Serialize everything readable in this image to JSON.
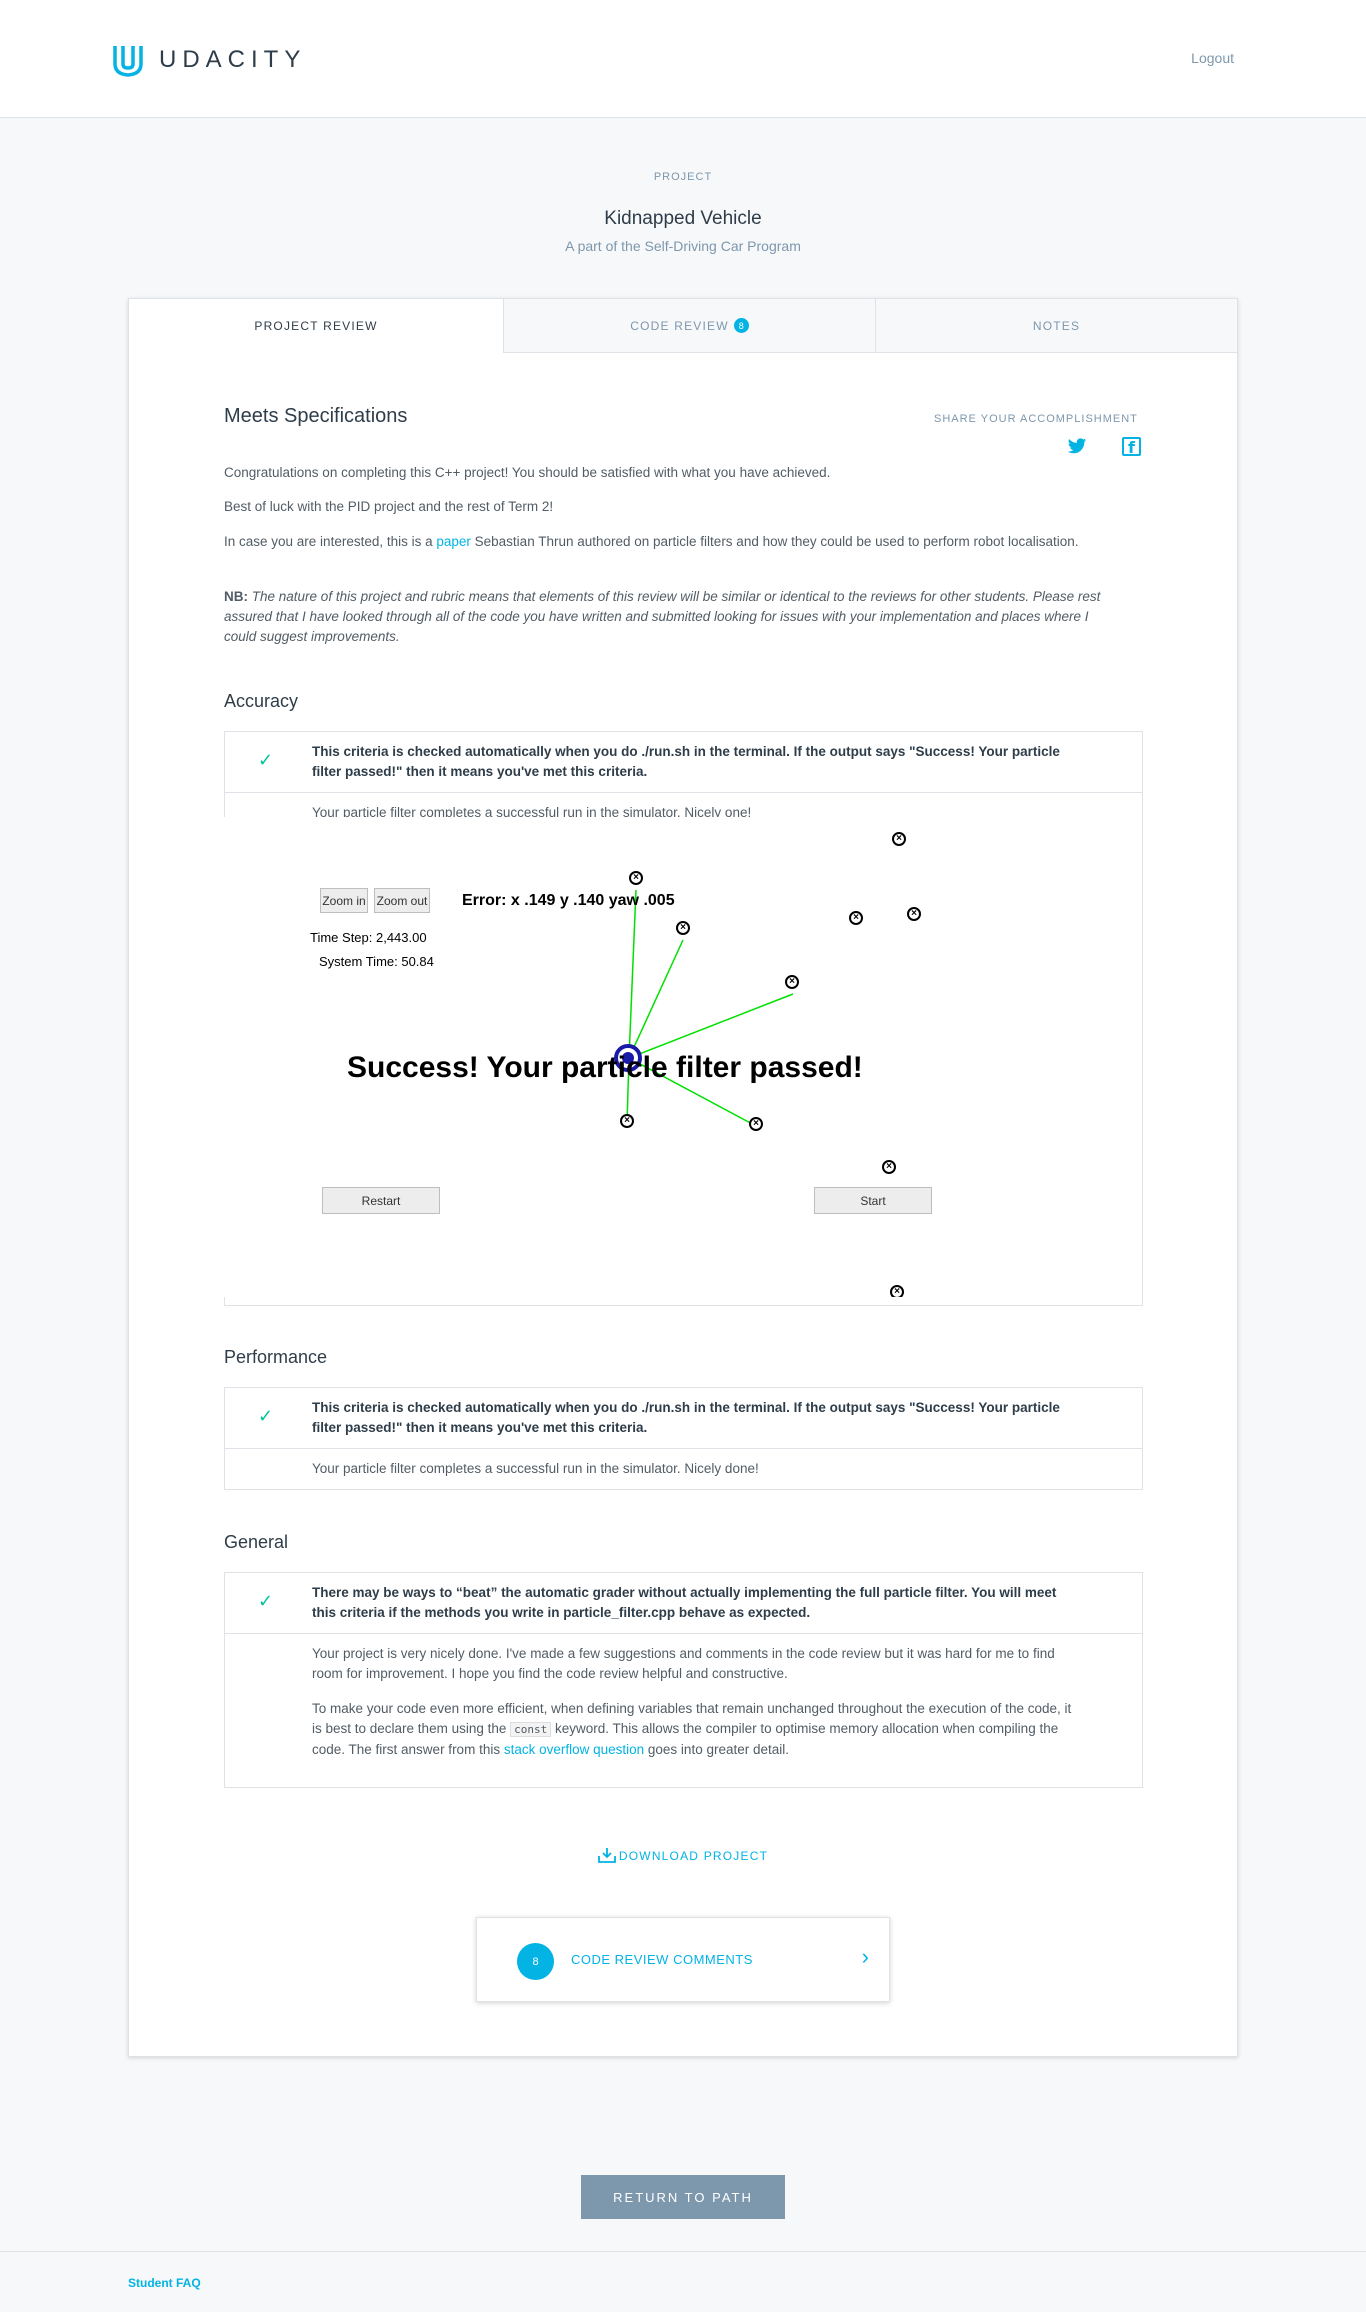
{
  "header": {
    "brand": "UDACITY",
    "logout": "Logout"
  },
  "project": {
    "eyebrow": "PROJECT",
    "title": "Kidnapped Vehicle",
    "subtitle": "A part of the Self-Driving Car Program"
  },
  "tabs": [
    {
      "label": "PROJECT REVIEW"
    },
    {
      "label": "CODE REVIEW",
      "badge": "8"
    },
    {
      "label": "NOTES"
    }
  ],
  "review": {
    "status": "Meets Specifications",
    "share_label": "SHARE YOUR ACCOMPLISHMENT",
    "p1": "Congratulations on completing this C++ project! You should be satisfied with what you have achieved.",
    "p2": "Best of luck with the PID project and the rest of Term 2!",
    "p3_before": "In case you are interested, this is a ",
    "p3_link": "paper",
    "p3_after": " Sebastian Thrun authored on particle filters and how they could be used to perform robot localisation.",
    "nb_label": "NB:",
    "nb_text": "The nature of this project and rubric means that elements of this review will be similar or identical to the reviews for other students. Please rest assured that I have looked through all of the code you have written and submitted looking for issues with your implementation and places where I could suggest improvements."
  },
  "sections": [
    {
      "title": "Accuracy",
      "criteria": "This criteria is checked automatically when you do ./run.sh in the terminal. If the output says \"Success! Your particle filter passed!\" then it means you've met this criteria.",
      "comment": "Your particle filter completes a successful run in the simulator. Nicely one!"
    },
    {
      "title": "Performance",
      "criteria": "This criteria is checked automatically when you do ./run.sh in the terminal. If the output says \"Success! Your particle filter passed!\" then it means you've met this criteria.",
      "comment": "Your particle filter completes a successful run in the simulator. Nicely done!"
    },
    {
      "title": "General",
      "criteria": "There may be ways to “beat” the automatic grader without actually implementing the full particle filter. You will meet this criteria if the methods you write in particle_filter.cpp behave as expected.",
      "comment": "Your project is very nicely done. I've made a few suggestions and comments in the code review but it was hard for me to find room for improvement. I hope you find the code review helpful and constructive.",
      "comment2_before": "To make your code even more efficient, when defining variables that remain unchanged throughout the execution of the code, it is best to declare them using the ",
      "comment2_code": "const",
      "comment2_mid": " keyword. This allows the compiler to optimise memory allocation when compiling the code. The first answer from this ",
      "comment2_link": "stack overflow question",
      "comment2_after": " goes into greater detail."
    }
  ],
  "simulator": {
    "zoom_in": "Zoom in",
    "zoom_out": "Zoom out",
    "error": "Error: x .149 y .140 yaw .005",
    "time_step": "Time Step: 2,443.00",
    "system_time": "System Time: 50.84",
    "success": "Success! Your particle filter passed!",
    "restart": "Restart",
    "start": "Start"
  },
  "actions": {
    "download": "DOWNLOAD PROJECT",
    "comments_count": "8",
    "comments_label": "CODE REVIEW COMMENTS",
    "return": "RETURN TO PATH"
  },
  "footer": {
    "faq": "Student FAQ"
  },
  "colors": {
    "accent": "#02b3e4",
    "check": "#02c39a",
    "button": "#7d97ad"
  }
}
